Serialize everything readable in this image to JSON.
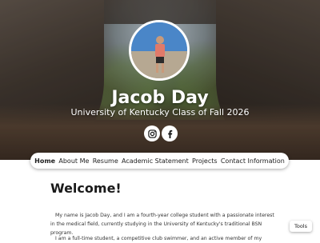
{
  "profile": {
    "name": "Jacob Day",
    "subtitle": "University of Kentucky Class of Fall 2026"
  },
  "social": [
    {
      "icon": "instagram-icon"
    },
    {
      "icon": "facebook-icon"
    }
  ],
  "nav": {
    "items": [
      {
        "label": "Home",
        "active": true
      },
      {
        "label": "About Me"
      },
      {
        "label": "Resume"
      },
      {
        "label": "Academic Statement"
      },
      {
        "label": "Projects"
      },
      {
        "label": "Contact Information"
      }
    ]
  },
  "main": {
    "heading": "Welcome!",
    "paragraphs": [
      "My name is Jacob Day, and I am a fourth-year college student with a passionate interest in the medical field, currently studying in the University of Kentucky's traditional BSN program.",
      "I am a full-time student, a competitive club swimmer, and an active member of my"
    ]
  },
  "tools": {
    "label": "Tools"
  },
  "colors": {
    "nav_bg": "#ffffff",
    "text": "#1a1a1a",
    "hero_overlay": "#000000"
  }
}
